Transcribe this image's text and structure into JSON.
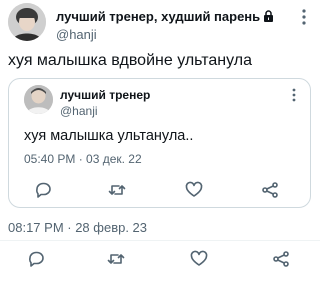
{
  "tweet": {
    "author_name": "лучший тренер, худший парень",
    "author_handle": "@hanji",
    "text": "хуя малышка вдвойне ультанула",
    "timestamp": "08:17 PM · 28 февр. 23",
    "account_locked": true
  },
  "quoted_tweet": {
    "author_name": "лучший тренер",
    "author_handle": "@hanji",
    "text": "хуя малышка ультанула..",
    "timestamp": "05:40 PM · 03 дек. 22"
  },
  "actions": [
    "reply-icon",
    "retweet-icon",
    "like-icon",
    "share-icon"
  ],
  "colors": {
    "text_primary": "#0f1419",
    "text_secondary": "#536471",
    "border": "#cfd9de"
  }
}
